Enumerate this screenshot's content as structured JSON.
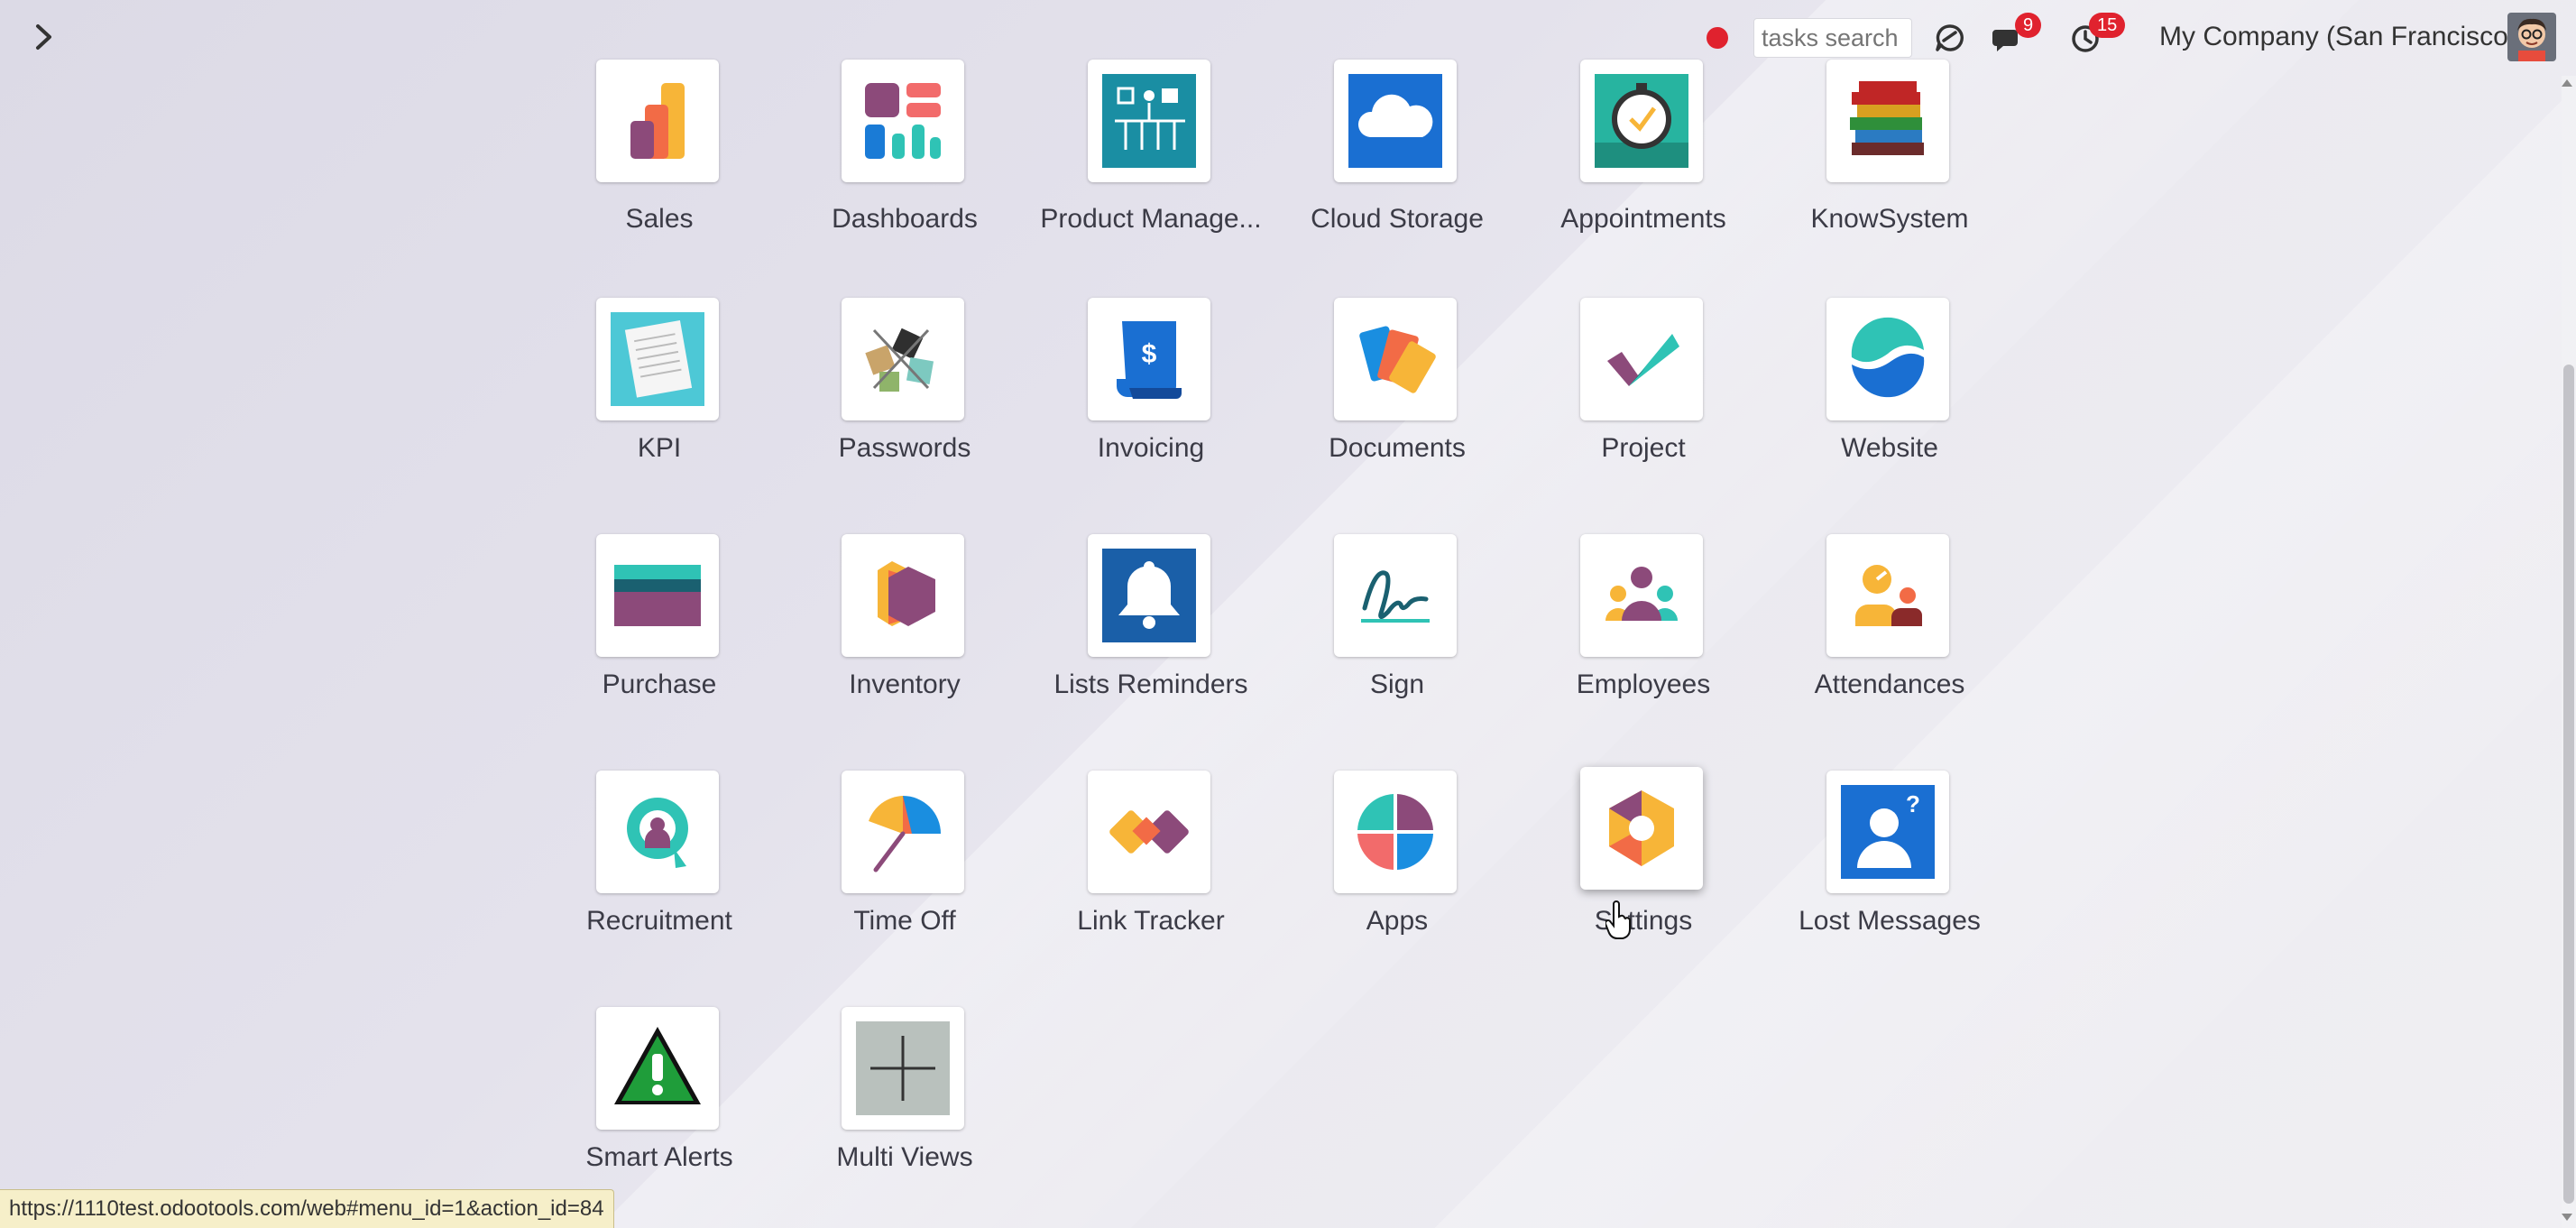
{
  "topbar": {
    "search_placeholder": "tasks search",
    "messages_count": "9",
    "activities_count": "15",
    "company": "My Company (San Francisco)"
  },
  "apps": [
    {
      "label": "Sales",
      "icon": "sales-icon"
    },
    {
      "label": "Dashboards",
      "icon": "dashboards-icon"
    },
    {
      "label": "Product Manage...",
      "icon": "product-management-icon"
    },
    {
      "label": "Cloud Storage",
      "icon": "cloud-storage-icon"
    },
    {
      "label": "Appointments",
      "icon": "appointments-icon"
    },
    {
      "label": "KnowSystem",
      "icon": "knowsystem-icon"
    },
    {
      "label": "KPI",
      "icon": "kpi-icon"
    },
    {
      "label": "Passwords",
      "icon": "passwords-icon"
    },
    {
      "label": "Invoicing",
      "icon": "invoicing-icon"
    },
    {
      "label": "Documents",
      "icon": "documents-icon"
    },
    {
      "label": "Project",
      "icon": "project-icon"
    },
    {
      "label": "Website",
      "icon": "website-icon"
    },
    {
      "label": "Purchase",
      "icon": "purchase-icon"
    },
    {
      "label": "Inventory",
      "icon": "inventory-icon"
    },
    {
      "label": "Lists Reminders",
      "icon": "lists-reminders-icon"
    },
    {
      "label": "Sign",
      "icon": "sign-icon"
    },
    {
      "label": "Employees",
      "icon": "employees-icon"
    },
    {
      "label": "Attendances",
      "icon": "attendances-icon"
    },
    {
      "label": "Recruitment",
      "icon": "recruitment-icon"
    },
    {
      "label": "Time Off",
      "icon": "time-off-icon"
    },
    {
      "label": "Link Tracker",
      "icon": "link-tracker-icon"
    },
    {
      "label": "Apps",
      "icon": "apps-icon"
    },
    {
      "label": "Settings",
      "icon": "settings-icon"
    },
    {
      "label": "Lost Messages",
      "icon": "lost-messages-icon"
    },
    {
      "label": "Smart Alerts",
      "icon": "smart-alerts-icon"
    },
    {
      "label": "Multi Views",
      "icon": "multi-views-icon"
    }
  ],
  "status_url": "https://1110test.odootools.com/web#menu_id=1&action_id=84"
}
